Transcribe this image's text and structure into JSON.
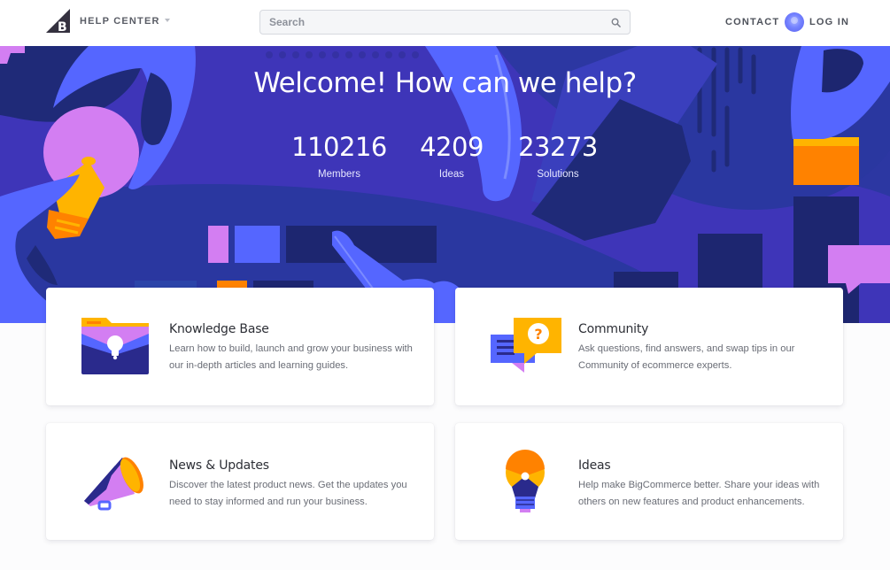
{
  "header": {
    "brand_label": "HELP CENTER",
    "logo_icon": "bigcommerce-logo",
    "search": {
      "placeholder": "Search",
      "value": "",
      "icon": "search-icon"
    },
    "contact_label": "CONTACT",
    "login_label": "LOG IN",
    "avatar_icon": "user-avatar-icon"
  },
  "hero": {
    "title": "Welcome! How can we help?",
    "stats": [
      {
        "value": "110216",
        "label": "Members"
      },
      {
        "value": "4209",
        "label": "Ideas"
      },
      {
        "value": "23273",
        "label": "Solutions"
      }
    ]
  },
  "cards": [
    {
      "title": "Knowledge Base",
      "description": "Learn how to build, launch and grow your business with our in-depth articles and learning guides.",
      "icon": "folder-lightbulb-icon"
    },
    {
      "title": "Community",
      "description": "Ask questions, find answers, and swap tips in our Community of ecommerce experts.",
      "icon": "chat-question-icon"
    },
    {
      "title": "News & Updates",
      "description": "Discover the latest product news. Get the updates you need to stay informed and run your business.",
      "icon": "megaphone-icon"
    },
    {
      "title": "Ideas",
      "description": "Help make BigCommerce better. Share your ideas with others on new features and product enhancements.",
      "icon": "lightbulb-icon"
    }
  ],
  "colors": {
    "hero_bg": "#3e35b8",
    "navy": "#1d2670",
    "blue": "#5566ff",
    "lilac": "#d37ef2",
    "orange": "#ff8200",
    "yellow": "#ffb400"
  }
}
